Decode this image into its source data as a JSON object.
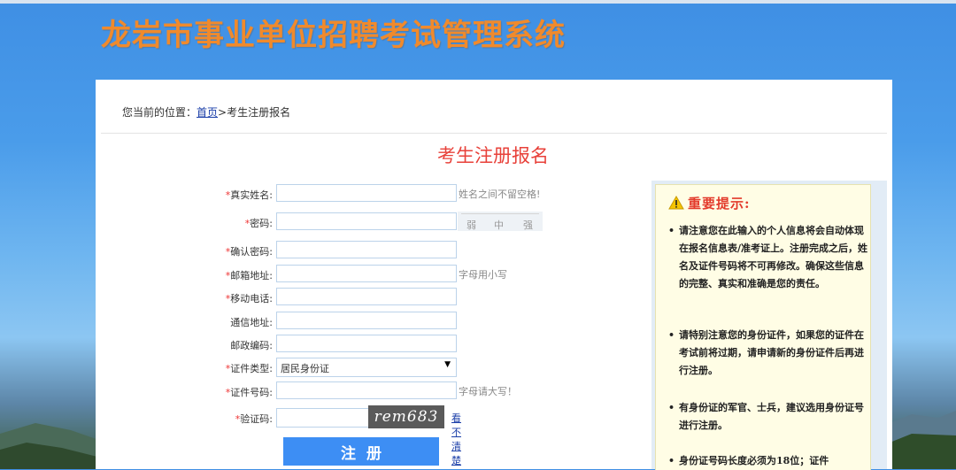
{
  "header": {
    "site_title": "龙岩市事业单位招聘考试管理系统"
  },
  "breadcrumb": {
    "prefix": "您当前的位置：",
    "home_link": "首页",
    "separator": ">",
    "current": "考生注册报名"
  },
  "page_heading": "考生注册报名",
  "form": {
    "fields": [
      {
        "label": "真实姓名:",
        "required": "*",
        "value": "",
        "hint": "姓名之间不留空格!"
      },
      {
        "label": "密码:",
        "required": "*",
        "value": ""
      },
      {
        "label": "确认密码:",
        "required": "*",
        "value": ""
      },
      {
        "label": "邮箱地址:",
        "required": "*",
        "value": "",
        "hint": "字母用小写"
      },
      {
        "label": "移动电话:",
        "required": "*",
        "value": ""
      },
      {
        "label": "通信地址:",
        "required": "",
        "value": ""
      },
      {
        "label": "邮政编码:",
        "required": "",
        "value": ""
      },
      {
        "label": "证件类型:",
        "required": "*",
        "value": "居民身份证"
      },
      {
        "label": "证件号码:",
        "required": "*",
        "value": "",
        "hint": "字母请大写！"
      },
      {
        "label": "验证码:",
        "required": "*",
        "value": ""
      }
    ],
    "password_strength": {
      "weak": "弱",
      "medium": "中",
      "strong": "强"
    },
    "captcha_text": "rem683",
    "captcha_refresh_link": "看不清楚",
    "submit_label": "注册"
  },
  "notice": {
    "title": "重要提示:",
    "items": [
      "请注意您在此输入的个人信息将会自动体现在报名信息表/准考证上。注册完成之后，姓名及证件号码将不可再修改。确保这些信息的完整、真实和准确是您的责任。",
      "请特别注意您的身份证件，如果您的证件在考试前将过期，请申请新的身份证件后再进行注册。",
      "有身份证的军官、士兵，建议选用身份证号进行注册。",
      "身份证号码长度必须为18位；证件"
    ]
  },
  "colors": {
    "accent_red": "#e8413a",
    "title_orange": "#f08a2c",
    "button_blue": "#3d8ef4"
  }
}
